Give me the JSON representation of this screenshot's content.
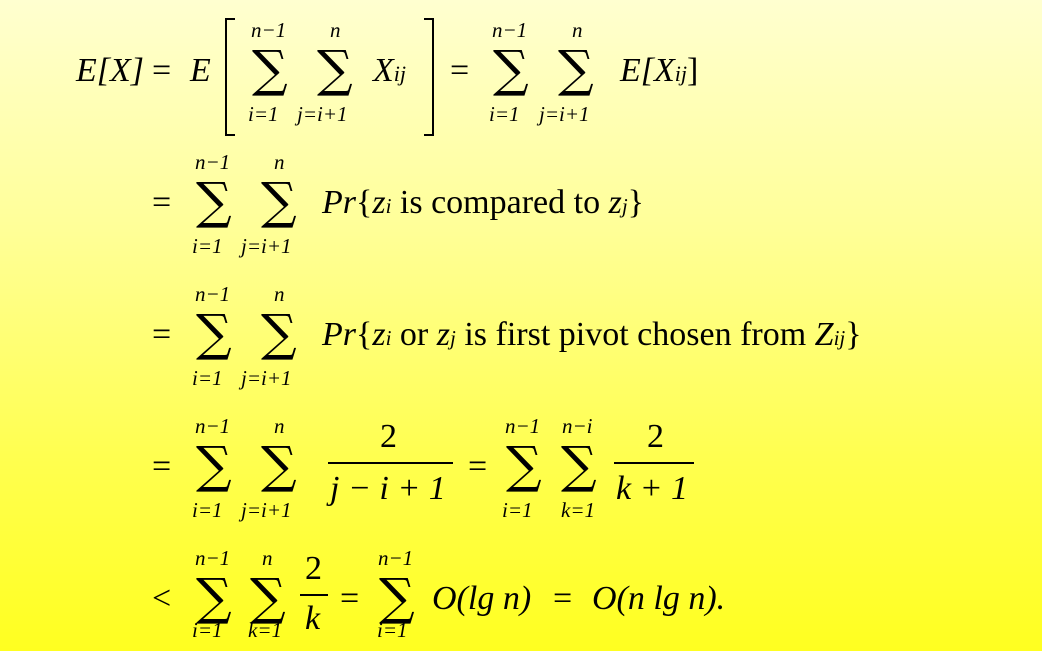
{
  "lines": [
    {
      "lhs": "E[X]",
      "eq": "=",
      "expr": "E",
      "sum1_top": "n−1",
      "sum1_bot": "i=1",
      "sum2_top": "n",
      "sum2_bot": "j=i+1",
      "term": "X",
      "term_sub": "ij",
      "eq2": "=",
      "sum3_top": "n−1",
      "sum3_bot": "i=1",
      "sum4_top": "n",
      "sum4_bot": "j=i+1",
      "term2": "E[X",
      "term2_sub": "ij",
      "term2_end": "]"
    },
    {
      "eq": "=",
      "sum1_top": "n−1",
      "sum1_bot": "i=1",
      "sum2_top": "n",
      "sum2_bot": "j=i+1",
      "pr": "Pr",
      "brace_open": "{",
      "z1": "z",
      "z1_sub": "i",
      "text": " is compared to ",
      "z2": "z",
      "z2_sub": "j",
      "brace_close": "}"
    },
    {
      "eq": "=",
      "sum1_top": "n−1",
      "sum1_bot": "i=1",
      "sum2_top": "n",
      "sum2_bot": "j=i+1",
      "pr": "Pr",
      "brace_open": "{",
      "z1": "z",
      "z1_sub": "i",
      "or": " or ",
      "z2": "z",
      "z2_sub": "j",
      "text": " is first pivot chosen from ",
      "Z": "Z",
      "Z_sub": "ij",
      "brace_close": "}"
    },
    {
      "eq": "=",
      "sum1_top": "n−1",
      "sum1_bot": "i=1",
      "sum2_top": "n",
      "sum2_bot": "j=i+1",
      "num": "2",
      "den": "j − i + 1",
      "eq2": "=",
      "sum3_top": "n−1",
      "sum3_bot": "i=1",
      "sum4_top": "n−i",
      "sum4_bot": "k=1",
      "num2": "2",
      "den2": "k + 1"
    },
    {
      "lt": "<",
      "sum1_top": "n−1",
      "sum1_bot": "i=1",
      "sum2_top": "n",
      "sum2_bot": "k=1",
      "num": "2",
      "den": "k",
      "eq2": "=",
      "sum3_top": "n−1",
      "sum3_bot": "i=1",
      "o1": "O(lg n)",
      "eq3": "=",
      "o2": "O(n lg n)."
    }
  ],
  "sigma": "∑"
}
